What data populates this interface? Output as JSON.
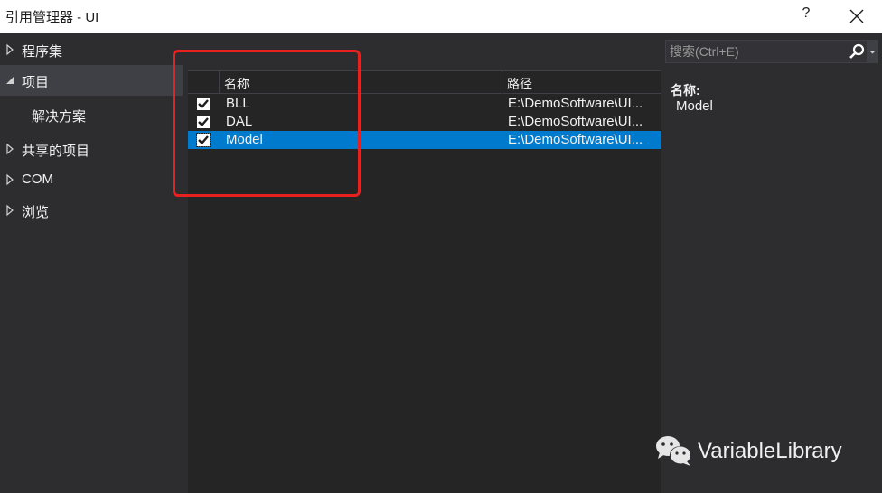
{
  "window": {
    "title": "引用管理器 - UI",
    "help_label": "?",
    "close_icon": "close-icon"
  },
  "sidebar": {
    "items": [
      {
        "label": "程序集",
        "expanded": false,
        "selected": false,
        "icon": "triangle-right-icon"
      },
      {
        "label": "项目",
        "expanded": true,
        "selected": true,
        "icon": "triangle-down-icon"
      },
      {
        "label": "解决方案",
        "child": true,
        "selected": false
      },
      {
        "label": "共享的项目",
        "expanded": false,
        "selected": false,
        "icon": "triangle-right-icon"
      },
      {
        "label": "COM",
        "expanded": false,
        "selected": false,
        "icon": "triangle-right-icon"
      },
      {
        "label": "浏览",
        "expanded": false,
        "selected": false,
        "icon": "triangle-right-icon"
      }
    ]
  },
  "grid": {
    "columns": [
      "名称",
      "路径"
    ],
    "rows": [
      {
        "checked": true,
        "name": "BLL",
        "path": "E:\\DemoSoftware\\UI...",
        "selected": false
      },
      {
        "checked": true,
        "name": "DAL",
        "path": "E:\\DemoSoftware\\UI...",
        "selected": false
      },
      {
        "checked": true,
        "name": "Model",
        "path": "E:\\DemoSoftware\\UI...",
        "selected": true
      }
    ]
  },
  "search": {
    "placeholder": "搜索(Ctrl+E)",
    "value": ""
  },
  "details": {
    "name_label": "名称:",
    "name_value": "Model"
  },
  "annotation": {
    "highlight_color": "#e8201f"
  },
  "watermark": {
    "text": "VariableLibrary",
    "icon": "wechat-icon"
  },
  "colors": {
    "accent": "#007acc",
    "background": "#2d2d30",
    "grid_background": "#252526"
  }
}
